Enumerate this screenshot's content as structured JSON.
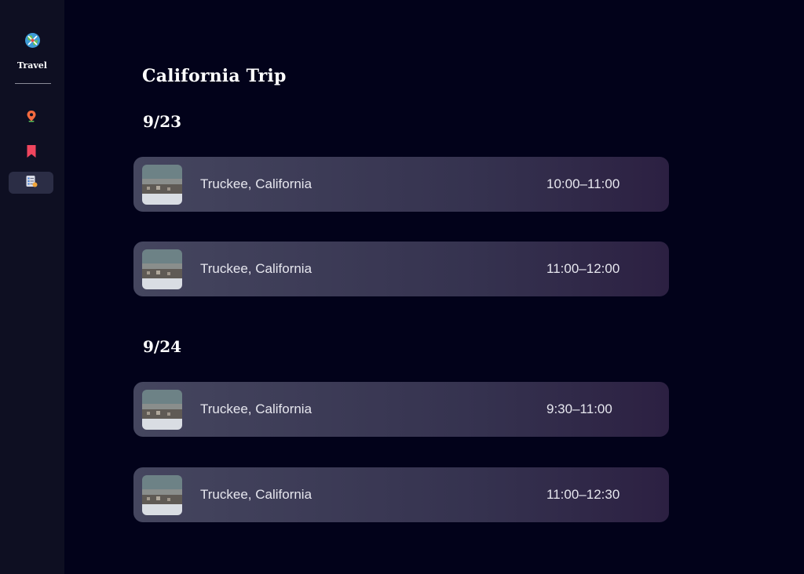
{
  "sidebar": {
    "app_name": "Travel",
    "logo_icon": "globe-icon",
    "items": [
      {
        "icon": "location-pin-icon",
        "active": false
      },
      {
        "icon": "bookmark-icon",
        "active": false
      },
      {
        "icon": "itinerary-list-icon",
        "active": true
      }
    ]
  },
  "main": {
    "title": "California Trip",
    "days": [
      {
        "date": "9/23",
        "entries": [
          {
            "place": "Truckee, California",
            "time": "10:00–11:00",
            "thumbnail_icon": "snowy-town-photo"
          },
          {
            "place": "Truckee, California",
            "time": "11:00–12:00",
            "thumbnail_icon": "snowy-town-photo"
          }
        ]
      },
      {
        "date": "9/24",
        "entries": [
          {
            "place": "Truckee, California",
            "time": "9:30–11:00",
            "thumbnail_icon": "snowy-town-photo"
          },
          {
            "place": "Truckee, California",
            "time": "11:00–12:30",
            "thumbnail_icon": "snowy-town-photo"
          }
        ]
      }
    ]
  },
  "colors": {
    "background": "#02021a",
    "sidebar": "#0e0f22",
    "card_start": "#45465f",
    "card_end": "#2c2042",
    "pin": "#f46a3f",
    "bookmark": "#f0455e"
  }
}
